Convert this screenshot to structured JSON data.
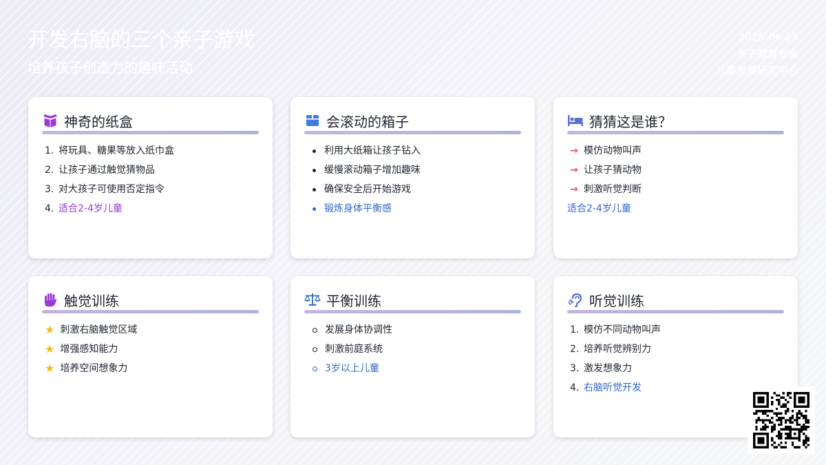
{
  "header": {
    "title": "开发右脑的三个亲子游戏",
    "subtitle": "培养孩子创造力的趣味活动",
    "date": "2025-06-28",
    "author": "亲子教育专家",
    "org": "儿童发展研究中心"
  },
  "colors": {
    "accent_purple": "#9b3bd3",
    "accent_blue": "#3168c4",
    "arrow_pink": "#e0457b",
    "star_yellow": "#f5b90f"
  },
  "cards": [
    {
      "icon": "box-open-icon",
      "title": "神奇的纸盒",
      "items": [
        "1.",
        "将玩具、糖果等放入纸巾盒",
        "2.",
        "让孩子通过触觉猜物品",
        "3.",
        "对大孩子可使用否定指令",
        "4.",
        "适合2-4岁儿童"
      ]
    },
    {
      "icon": "box-icon",
      "title": "会滚动的箱子",
      "items": [
        "利用大纸箱让孩子钻入",
        "缓慢滚动箱子增加趣味",
        "确保安全后开始游戏",
        "锻炼身体平衡感"
      ]
    },
    {
      "icon": "bed-icon",
      "title": "猜猜这是谁？",
      "items": [
        "模仿动物叫声",
        "让孩子猜动物",
        "刺激听觉判断",
        "适合2-4岁儿童"
      ]
    },
    {
      "icon": "hand-icon",
      "title": "触觉训练",
      "items": [
        "刺激右脑触觉区域",
        "增强感知能力",
        "培养空间想象力"
      ]
    },
    {
      "icon": "balance-scale-icon",
      "title": "平衡训练",
      "items": [
        "发展身体协调性",
        "刺激前庭系统",
        "3岁以上儿童"
      ]
    },
    {
      "icon": "ear-icon",
      "title": "听觉训练",
      "items": [
        "1.",
        "模仿不同动物叫声",
        "2.",
        "培养听觉辨别力",
        "3.",
        "激发想象力",
        "4.",
        "右脑听觉开发"
      ]
    }
  ],
  "qr": {
    "icon": "qr-code-icon"
  }
}
